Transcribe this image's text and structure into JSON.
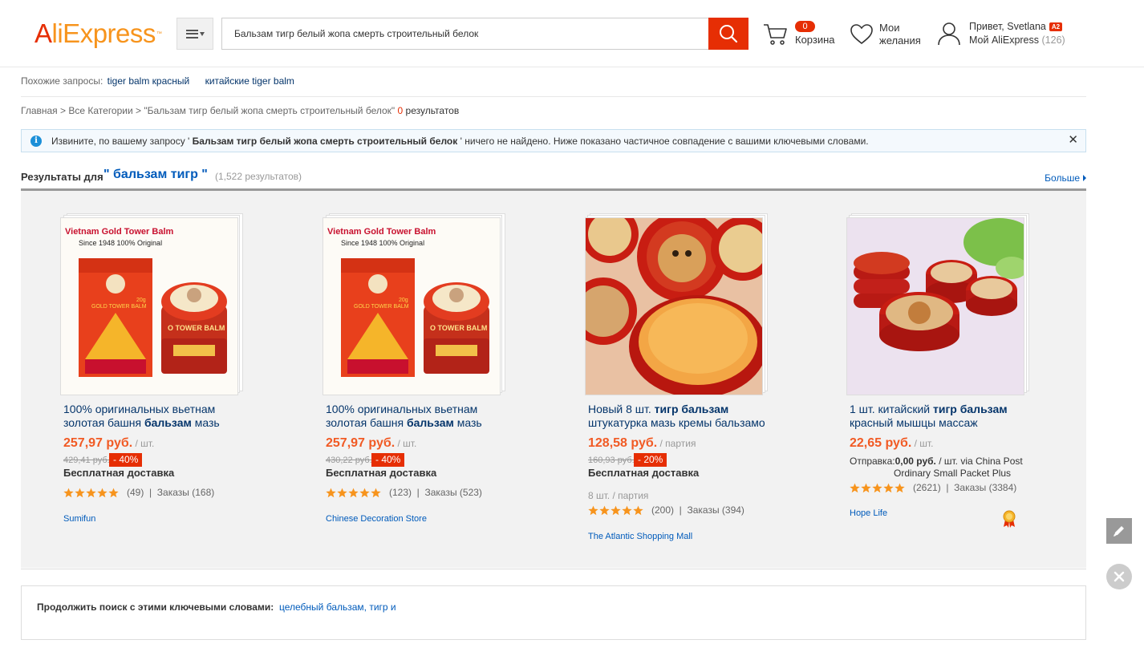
{
  "header": {
    "logo_main": "AliExpress",
    "search_value": "Бальзам тигр белый жопа смерть строительный белок",
    "cart_count": "0",
    "cart_label": "Корзина",
    "wishlist_line1": "Мои",
    "wishlist_line2": "желания",
    "account_hello": "Привет, Svetlana",
    "account_badge": "A2",
    "account_my": "Мой AliExpress",
    "account_count": "(126)"
  },
  "related": {
    "label": "Похожие запросы:",
    "items": [
      "tiger balm красный",
      "китайские tiger balm"
    ]
  },
  "breadcrumb": {
    "home": "Главная",
    "sep1": " > ",
    "all": "Все Категории",
    "sep2": " > ",
    "query": "\"Бальзам тигр белый жопа смерть строительный белок\"",
    "zero": "0",
    "results": "результатов"
  },
  "notice": {
    "pre": "Извините, по вашему запросу '",
    "query": "Бальзам тигр белый жопа смерть строительный белок",
    "post": "' ничего не найдено. Ниже показано частичное совпадение с вашими ключевыми словами."
  },
  "results": {
    "label": "Результаты для",
    "term": "\" бальзам тигр \"",
    "count": "(1,522 результатов)",
    "more": "Больше"
  },
  "products": [
    {
      "title_pre": "100% оригинальных вьетнам золотая башня ",
      "title_bold": "бальзам",
      "title_post": " мазь",
      "price": "257,97 руб.",
      "unit": " / шт.",
      "old_price": "429,41 руб.",
      "discount": "- 40%",
      "shipping": "Бесплатная доставка",
      "reviews": "(49)",
      "orders": "Заказы (168)",
      "store": "Sumifun",
      "image_label1": "Vietnam Gold Tower Balm",
      "image_label2": "Since 1948   100% Original"
    },
    {
      "title_pre": "100% оригинальных вьетнам золотая башня ",
      "title_bold": "бальзам",
      "title_post": " мазь",
      "price": "257,97 руб.",
      "unit": " / шт.",
      "old_price": "430,22 руб.",
      "discount": "- 40%",
      "shipping": "Бесплатная доставка",
      "reviews": "(123)",
      "orders": "Заказы (523)",
      "store": "Chinese Decoration Store",
      "image_label1": "Vietnam Gold Tower Balm",
      "image_label2": "Since 1948   100% Original"
    },
    {
      "title_pre": "Новый 8 шт. ",
      "title_bold": "тигр бальзам",
      "title_post": " штукатурка мазь кремы бальзамо",
      "price": "128,58 руб.",
      "unit": " / партия",
      "old_price": "160,93 руб.",
      "discount": "- 20%",
      "shipping": "Бесплатная доставка",
      "lot": "8 шт. / партия",
      "reviews": "(200)",
      "orders": "Заказы (394)",
      "store": "The Atlantic Shopping Mall"
    },
    {
      "title_pre": "1 шт. китайский ",
      "title_bold": "тигр бальзам",
      "title_post": " красный мышцы массаж",
      "price": "22,65 руб.",
      "unit": " / шт.",
      "ship_pre": "Отправка:",
      "ship_price": "0,00 руб.",
      "ship_post": " / шт. via China Post",
      "ship_line2": "Ordinary Small Packet Plus",
      "reviews": "(2621)",
      "orders": "Заказы (3384)",
      "store": "Hope Life"
    }
  ],
  "continue": {
    "label": "Продолжить поиск с этими ключевыми словами:",
    "links": "целебный бальзам, тигр и"
  },
  "colors": {
    "accent": "#e62e04",
    "price": "#f15a24",
    "link": "#005bbb",
    "star": "#f7941d"
  }
}
